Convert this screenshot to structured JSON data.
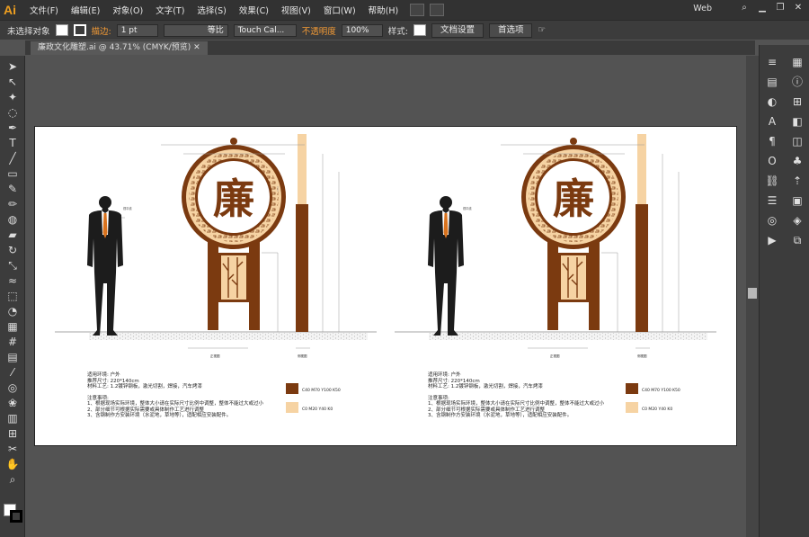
{
  "app": {
    "logo": "Ai"
  },
  "menu": [
    "文件(F)",
    "编辑(E)",
    "对象(O)",
    "文字(T)",
    "选择(S)",
    "效果(C)",
    "视图(V)",
    "窗口(W)",
    "帮助(H)"
  ],
  "workspace": "Web",
  "control_bar": {
    "selection_label": "未选择对象",
    "stroke_label": "描边:",
    "stroke_value": "1 pt",
    "profile_label": "等比",
    "brush_value": "Touch Cal...",
    "opacity_label": "不透明度",
    "opacity_value": "100%",
    "style_label": "样式:",
    "doc_setup_button": "文档设置",
    "prefs_button": "首选项"
  },
  "document_tab": "廉政文化雕塑.ai @ 43.71% (CMYK/预览)",
  "artwork": {
    "character": "廉",
    "left_panel": {
      "height_label": "视平线",
      "front_view": "正视图",
      "side_view": "侧视图",
      "notes": [
        "适用环境: 户外",
        "推荐尺寸: 220*140cm",
        "材料工艺: 1.2镀锌钢板，激光切割，焊接，汽车烤漆",
        "",
        "注意事项:",
        "1、根据现场实际环境，整体大小请在实际尺寸比例中调整，整体不能过大或过小",
        "2、部分细节可根据实际需要或具体制作工艺进行调整",
        "3、含钢制作方安装环境（水泥地，草地等），适配相应安装配件。"
      ]
    },
    "right_panel": {
      "height_label": "视平线",
      "front_view": "正视图",
      "side_view": "侧视图",
      "notes": [
        "适用环境: 户外",
        "推荐尺寸: 220*140cm",
        "材料工艺: 1.2镀锌钢板，激光切割，焊接，汽车烤漆",
        "",
        "注意事项:",
        "1、根据现场实际环境，整体大小请在实际尺寸比例中调整，整体不能过大或过小",
        "2、部分细节可根据实际需要或具体制作工艺进行调整",
        "3、含钢制作方安装环境（水泥地，草地等），适配相应安装配件。"
      ]
    },
    "color_legend": [
      {
        "color": "#7b3a10",
        "text": "C40  M70  Y100  K50"
      },
      {
        "color": "#f6d3a3",
        "text": "C0  M20  Y40  K0"
      }
    ],
    "colors": {
      "brown": "#7b3a10",
      "beige": "#f6d3a3",
      "silhouette": "#1c1c1c",
      "tie": "#d9731e"
    }
  },
  "icons": {
    "tools": [
      "selection-icon",
      "direct-selection-icon",
      "magic-wand-icon",
      "lasso-icon",
      "pen-icon",
      "type-icon",
      "line-icon",
      "rectangle-icon",
      "paintbrush-icon",
      "pencil-icon",
      "blob-brush-icon",
      "eraser-icon",
      "rotate-icon",
      "scale-icon",
      "warp-icon",
      "free-transform-icon",
      "shape-builder-icon",
      "perspective-icon",
      "mesh-icon",
      "gradient-icon",
      "eyedropper-icon",
      "blend-icon",
      "symbol-sprayer-icon",
      "column-graph-icon",
      "artboard-icon",
      "slice-icon",
      "hand-icon",
      "zoom-icon"
    ],
    "dock": [
      "color-panel-icon",
      "gradient-panel-icon",
      "transparency-panel-icon",
      "character-panel-icon",
      "paragraph-panel-icon",
      "opentype-panel-icon",
      "links-panel-icon",
      "stroke-panel-icon",
      "graphic-styles-panel-icon",
      "actions-panel-icon",
      "transform-panel-icon",
      "info-panel-icon",
      "align-panel-icon",
      "pathfinder-panel-icon",
      "appearance-panel-icon",
      "symbols-panel-icon",
      "brushes-panel-icon",
      "swatches-panel-icon",
      "layers-panel-icon",
      "artboards-panel-icon"
    ]
  }
}
